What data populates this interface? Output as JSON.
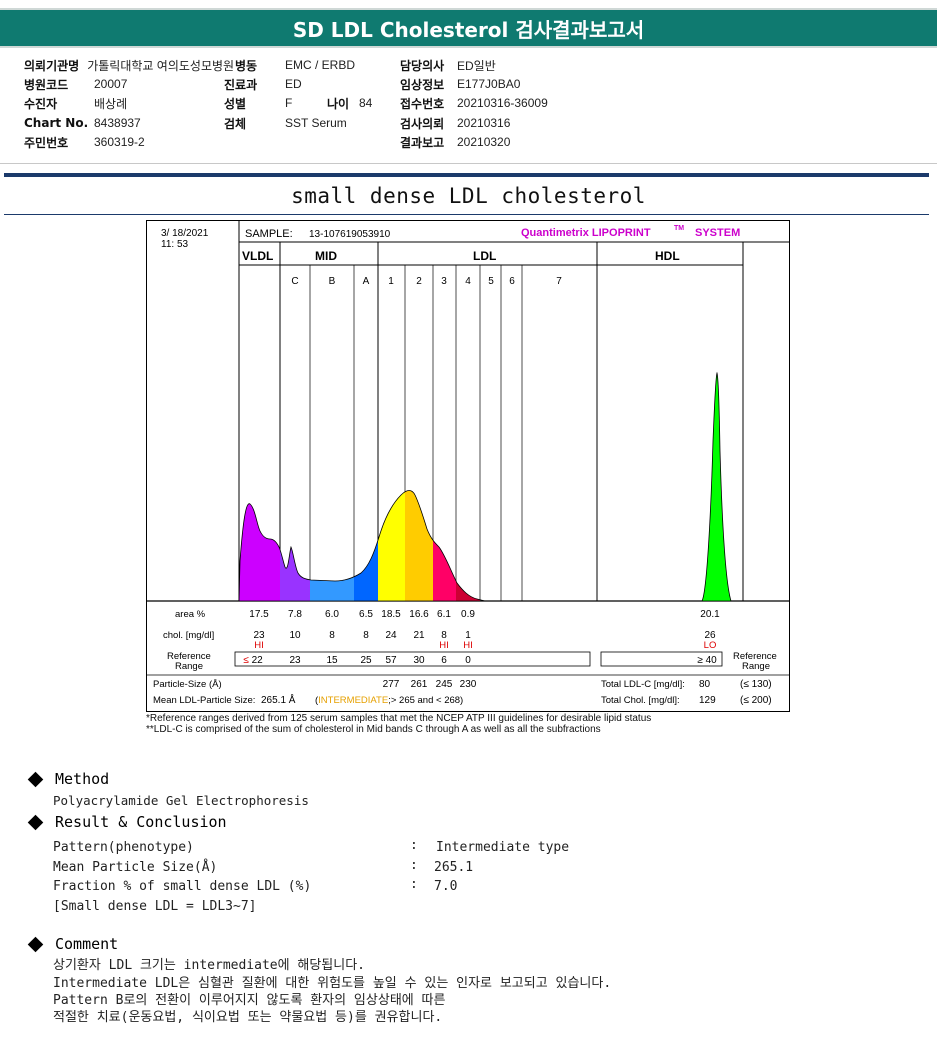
{
  "header": {
    "title": "SD LDL Cholesterol 검사결과보고서"
  },
  "patient_info": {
    "col1": [
      {
        "label": "의뢰기관명",
        "value": "가톨릭대학교 여의도성모병원"
      },
      {
        "label": "병원코드",
        "value": "20007"
      },
      {
        "label": "수진자",
        "value": "배상례"
      },
      {
        "label": "Chart No.",
        "value": "8438937"
      },
      {
        "label": "주민번호",
        "value": "360319-2"
      }
    ],
    "col2": [
      {
        "label": "병동",
        "value": "EMC / ERBD"
      },
      {
        "label": "진료과",
        "value": "ED"
      },
      {
        "label": "성별",
        "value": "F"
      },
      {
        "label": "검체",
        "value": "SST Serum"
      }
    ],
    "age": {
      "label": "나이",
      "value": "84"
    },
    "col3": [
      {
        "label": "담당의사",
        "value": "ED일반"
      },
      {
        "label": "임상정보",
        "value": "E177J0BA0"
      },
      {
        "label": "접수번호",
        "value": "20210316-36009"
      },
      {
        "label": "검사의뢰",
        "value": "20210316"
      },
      {
        "label": "결과보고",
        "value": "20210320"
      }
    ]
  },
  "section_title": "small dense LDL cholesterol",
  "report": {
    "date": "3/ 18/2021",
    "time": "11: 53",
    "sample_label": "SAMPLE:",
    "sample_id": "13-107619053910",
    "system_brand": "Quantimetrix LIPOPRINT",
    "system_tm": "TM",
    "system_suffix": "SYSTEM",
    "groups": {
      "vldl": "VLDL",
      "mid": "MID",
      "ldl": "LDL",
      "hdl": "HDL"
    },
    "sub_bands": [
      "C",
      "B",
      "A",
      "1",
      "2",
      "3",
      "4",
      "5",
      "6",
      "7"
    ],
    "row_labels": {
      "area": "area %",
      "chol": "chol. [mg/dl]",
      "ref_1": "Reference",
      "ref_2": "Range",
      "ref_right_1": "Reference",
      "ref_right_2": "Range"
    },
    "area_values": [
      "17.5",
      "7.8",
      "6.0",
      "6.5",
      "18.5",
      "16.6",
      "6.1",
      "0.9",
      "20.1"
    ],
    "chol_values": [
      "23",
      "10",
      "8",
      "8",
      "24",
      "21",
      "8",
      "1",
      "26"
    ],
    "flags": [
      "HI",
      "HI",
      "HI",
      "LO"
    ],
    "ref_values": [
      "≤ 22",
      "23",
      "15",
      "25",
      "57",
      "30",
      "6",
      "0",
      "≥ 40"
    ],
    "particle_size_label": "Particle-Size (Å)",
    "particle_sizes": [
      "277",
      "261",
      "245",
      "230"
    ],
    "total_ldl_label": "Total LDL-C [mg/dl]:",
    "total_ldl_value": "80",
    "total_ldl_ref": "(≤ 130)",
    "mean_size_label": "Mean LDL-Particle Size:",
    "mean_size_value": "265.1 Å",
    "mean_size_type": "INTERMEDIATE",
    "mean_size_range": "> 265 and < 268)",
    "total_chol_label": "Total Chol. [mg/dl]:",
    "total_chol_value": "129",
    "total_chol_ref": "(≤ 200)"
  },
  "chart_data": {
    "type": "area",
    "title": "",
    "xlabel": "",
    "ylabel": "",
    "x": [
      "VLDL",
      "C",
      "B",
      "A",
      "1",
      "2",
      "3",
      "4",
      "HDL"
    ],
    "area_percent": [
      17.5,
      7.8,
      6.0,
      6.5,
      18.5,
      16.6,
      6.1,
      0.9,
      20.1
    ],
    "chol_mg_dl": [
      23,
      10,
      8,
      8,
      24,
      21,
      8,
      1,
      26
    ],
    "band_colors": [
      "#cc00ff",
      "#9933ff",
      "#3399ff",
      "#0066ff",
      "#ffff00",
      "#ffcc00",
      "#ff0066",
      "#cc0033",
      "#00ff00"
    ],
    "grid": false,
    "legend": "none"
  },
  "footnotes": [
    "*Reference ranges derived from 125 serum samples that met the NCEP ATP III guidelines for desirable lipid status",
    "**LDL-C is comprised of the sum of cholesterol in Mid bands C through A as well as all the subfractions"
  ],
  "method": {
    "heading": "Method",
    "text": "Polyacrylamide Gel Electrophoresis"
  },
  "result": {
    "heading": "Result & Conclusion",
    "rows": [
      {
        "label": "Pattern(phenotype)",
        "value": "Intermediate type"
      },
      {
        "label": "Mean Particle Size(Å)",
        "value": "265.1"
      },
      {
        "label": "Fraction % of small dense LDL (%)",
        "value": "7.0"
      }
    ],
    "separator": ":",
    "note": "[Small dense LDL = LDL3~7]"
  },
  "comment": {
    "heading": "Comment",
    "lines": [
      "상기환자 LDL 크기는 intermediate에 해당됩니다.",
      "Intermediate LDL은 심혈관 질환에 대한 위험도를 높일 수 있는 인자로 보고되고 있습니다.",
      "Pattern B로의 전환이 이루어지지 않도록 환자의 임상상태에 따른",
      "적절한 치료(운동요법, 식이요법 또는 약물요법 등)를 권유합니다."
    ]
  }
}
